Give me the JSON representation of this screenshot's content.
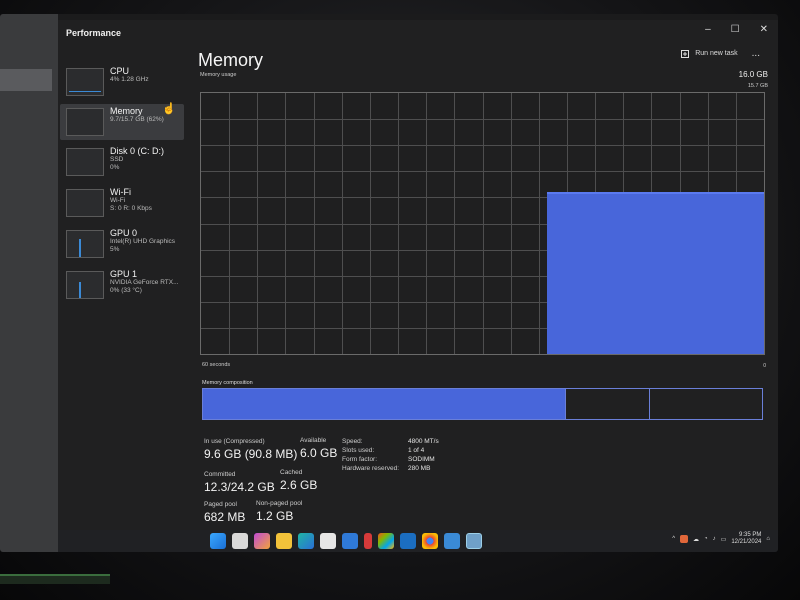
{
  "window": {
    "title": "Performance",
    "controls": [
      "–",
      "☐",
      "✕"
    ]
  },
  "toolbar": {
    "run_task_label": "Run new task",
    "more_label": "..."
  },
  "sidebar": {
    "items": [
      {
        "name": "CPU",
        "line1": "4% 1.28 GHz",
        "line2": ""
      },
      {
        "name": "Memory",
        "line1": "9.7/15.7 GB (62%)",
        "line2": ""
      },
      {
        "name": "Disk 0 (C: D:)",
        "line1": "SSD",
        "line2": "0%"
      },
      {
        "name": "Wi-Fi",
        "line1": "Wi-Fi",
        "line2": "S: 0 R: 0 Kbps"
      },
      {
        "name": "GPU 0",
        "line1": "Intel(R) UHD Graphics",
        "line2": "5%"
      },
      {
        "name": "GPU 1",
        "line1": "NVIDIA GeForce RTX...",
        "line2": "0% (33 °C)"
      }
    ]
  },
  "main": {
    "heading": "Memory",
    "total": "16.0 GB",
    "usage_label": "Memory usage",
    "usage_current": "15.7 GB",
    "seconds_label": "60 seconds",
    "zero_label": "0",
    "composition_label": "Memory composition",
    "usage_fraction": 0.62,
    "composition": {
      "in_use_fraction": 0.65,
      "modified_fraction": 0.15,
      "standby_fraction": 0.2
    }
  },
  "stats": {
    "in_use_label": "In use (Compressed)",
    "in_use_value": "9.6 GB (90.8 MB)",
    "available_label": "Available",
    "available_value": "6.0 GB",
    "committed_label": "Committed",
    "committed_value": "12.3/24.2 GB",
    "cached_label": "Cached",
    "cached_value": "2.6 GB",
    "paged_label": "Paged pool",
    "paged_value": "682 MB",
    "nonpaged_label": "Non-paged pool",
    "nonpaged_value": "1.2 GB"
  },
  "props": [
    {
      "k": "Speed:",
      "v": "4800 MT/s"
    },
    {
      "k": "Slots used:",
      "v": "1 of 4"
    },
    {
      "k": "Form factor:",
      "v": "SODIMM"
    },
    {
      "k": "Hardware reserved:",
      "v": "280 MB"
    }
  ],
  "taskbar": {
    "time": "9:35 PM",
    "date": "12/21/2024",
    "tray_arrow": "^"
  },
  "colors": {
    "accent": "#4866da",
    "window_bg": "#202021"
  }
}
